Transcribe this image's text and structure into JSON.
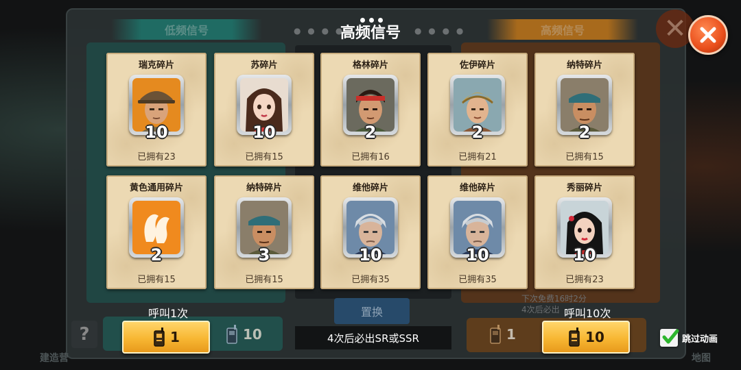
{
  "background": {
    "left_tab": "低频信号",
    "right_tab": "高频信号",
    "swap_label": "置换",
    "free_text_line1": "下次免费16时2分",
    "free_text_line2": "4次后必出",
    "left_small_count": "10",
    "right_small_count": "1",
    "help": "?",
    "side_label_left": "建造营",
    "side_label_right": "地图"
  },
  "header": {
    "title": "高频信号"
  },
  "close": {
    "icon": "close-icon"
  },
  "cards": [
    {
      "name": "瑞克碎片",
      "count": "10",
      "owned": "已拥有23",
      "portrait": "rick-portrait-icon"
    },
    {
      "name": "苏碎片",
      "count": "10",
      "owned": "已拥有15",
      "portrait": "su-portrait-icon"
    },
    {
      "name": "格林碎片",
      "count": "2",
      "owned": "已拥有16",
      "portrait": "green-portrait-icon"
    },
    {
      "name": "佐伊碎片",
      "count": "2",
      "owned": "已拥有21",
      "portrait": "zoe-portrait-icon"
    },
    {
      "name": "纳特碎片",
      "count": "2",
      "owned": "已拥有15",
      "portrait": "nate-portrait-icon"
    },
    {
      "name": "黄色通用碎片",
      "count": "2",
      "owned": "已拥有15",
      "portrait": "universal-shard-icon"
    },
    {
      "name": "纳特碎片",
      "count": "3",
      "owned": "已拥有15",
      "portrait": "nate-portrait-icon"
    },
    {
      "name": "维他碎片",
      "count": "10",
      "owned": "已拥有35",
      "portrait": "vita-portrait-icon"
    },
    {
      "name": "维他碎片",
      "count": "10",
      "owned": "已拥有35",
      "portrait": "vita-portrait-icon"
    },
    {
      "name": "秀丽碎片",
      "count": "10",
      "owned": "已拥有23",
      "portrait": "xiuli-portrait-icon"
    }
  ],
  "footer": {
    "call_once_label": "呼叫1次",
    "call_once_cost": "1",
    "call_ten_label": "呼叫10次",
    "call_ten_cost": "10",
    "guarantee_text": "4次后必出SR或SSR",
    "skip_label": "跳过动画",
    "skip_checked": true
  },
  "colors": {
    "card_bg": "#ecd9b3",
    "button_gold": "#f7b733",
    "close_orange": "#e94e1b",
    "check_green": "#2db52d"
  }
}
